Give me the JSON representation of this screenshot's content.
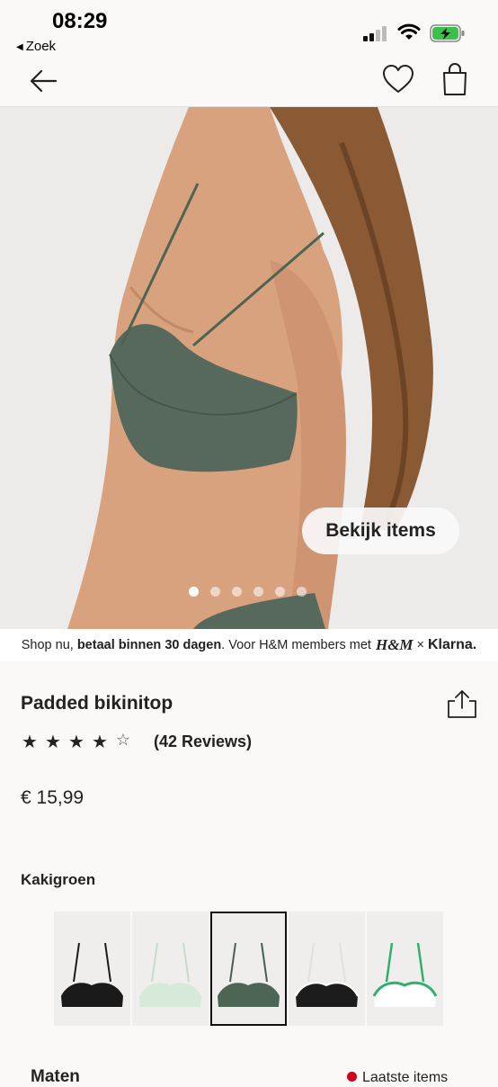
{
  "status_bar": {
    "time": "08:29",
    "back_app": "Zoek",
    "icons": [
      "cellular-signal-icon",
      "wifi-icon",
      "battery-charging-icon"
    ]
  },
  "nav": {
    "icons": [
      "back-arrow-icon",
      "heart-icon",
      "shopping-bag-icon"
    ]
  },
  "hero": {
    "view_items_label": "Bekijk items",
    "carousel_dot_count": 6,
    "carousel_active_index": 0
  },
  "banner": {
    "prefix": "Shop nu, ",
    "bold": "betaal binnen 30 dagen",
    "middle": ". Voor H&M members met ",
    "hm_logo": "H&M",
    "times": "×",
    "klarna": "Klarna."
  },
  "product": {
    "title": "Padded bikinitop",
    "rating": 4,
    "rating_max": 5,
    "reviews": "(42 Reviews)",
    "price": "€ 15,99",
    "color_name": "Kakigroen",
    "swatches": [
      {
        "name": "black",
        "color": "#1a1a1a",
        "strap": "#1a1a1a",
        "trim": ""
      },
      {
        "name": "mint",
        "color": "#d6ead9",
        "strap": "#bcd6c0",
        "trim": ""
      },
      {
        "name": "kakigroen",
        "color": "#4d6555",
        "strap": "#4a5e50",
        "trim": "",
        "selected": true
      },
      {
        "name": "black-white",
        "color": "#1c1c1c",
        "strap": "#e8e8e8",
        "trim": "#ffffff"
      },
      {
        "name": "white-green",
        "color": "#ffffff",
        "strap": "#2fae72",
        "trim": "#2fae72"
      }
    ]
  },
  "bottom": {
    "sizes_label": "Maten",
    "stock_label": "Laatste items"
  },
  "colors": {
    "background": "#faf9f8",
    "text": "#222222",
    "stock_dot": "#d0021b"
  }
}
